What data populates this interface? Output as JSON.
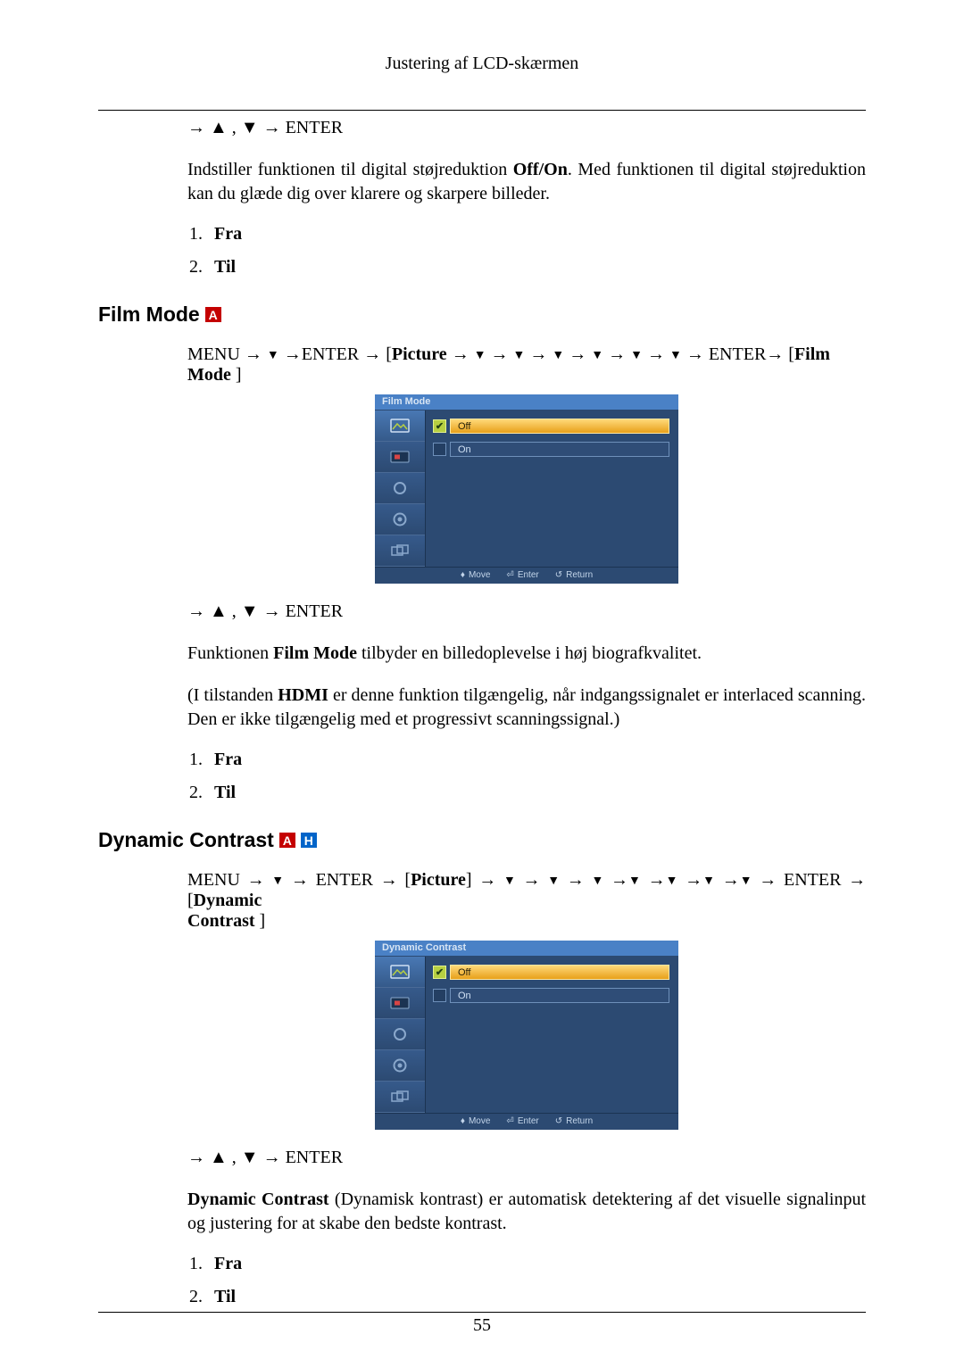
{
  "header": {
    "title": "Justering af LCD-skærmen"
  },
  "arrows": {
    "right": "→",
    "up": "▲",
    "down": "▼"
  },
  "nav_enter": "ENTER",
  "section1": {
    "nav_line_html": "→ ▲ , ▼ → ENTER",
    "desc_pre": "Indstiller funktionen til digital støjreduktion ",
    "desc_bold": "Off/On",
    "desc_post": ". Med funktionen til digital støjreduktion kan du glæde dig over klarere og skarpere billeder.",
    "opts": [
      "Fra",
      "Til"
    ]
  },
  "sectionFilm": {
    "title": "Film Mode",
    "badgeA": "A",
    "nav": {
      "menu": "MENU",
      "enter": "ENTER",
      "picture": "Picture",
      "film_mode": "Film Mode"
    },
    "osd": {
      "title": "Film Mode",
      "off": "Off",
      "on": "On",
      "foot_move": "Move",
      "foot_enter": "Enter",
      "foot_return": "Return"
    },
    "nav_line2": "→ ▲ , ▼ → ENTER",
    "para1_pre": "Funktionen ",
    "para1_bold": "Film Mode",
    "para1_post": " tilbyder en billedoplevelse i høj biografkvalitet.",
    "para2_pre": "(I tilstanden ",
    "para2_bold": "HDMI",
    "para2_post": " er denne funktion tilgængelig, når indgangssignalet er interlaced scanning. Den er ikke tilgængelig med et progressivt scanningssignal.)",
    "opts": [
      "Fra",
      "Til"
    ]
  },
  "sectionDC": {
    "title": "Dynamic Contrast",
    "badgeA": "A",
    "badgeH": "H",
    "nav": {
      "menu": "MENU",
      "enter": "ENTER",
      "picture": "Picture",
      "dc1": "Dynamic",
      "dc2": "Contrast"
    },
    "osd": {
      "title": "Dynamic Contrast",
      "off": "Off",
      "on": "On",
      "foot_move": "Move",
      "foot_enter": "Enter",
      "foot_return": "Return"
    },
    "nav_line2": "→ ▲ , ▼ → ENTER",
    "para_bold": "Dynamic Contrast",
    "para_post": " (Dynamisk kontrast) er automatisk detektering af det visuelle signalinput og justering for at skabe den bedste kontrast.",
    "opts": [
      "Fra",
      "Til"
    ]
  },
  "page_number": "55"
}
